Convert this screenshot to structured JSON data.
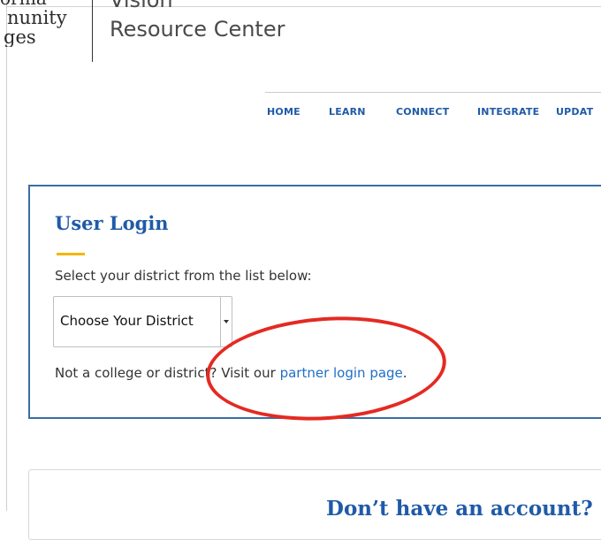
{
  "header": {
    "logo_lines": [
      "ornia",
      "nunity",
      "ges"
    ],
    "site_title_line1": "Vision",
    "site_title_line2": "Resource Center"
  },
  "nav": {
    "items": [
      {
        "label": "HOME"
      },
      {
        "label": "LEARN"
      },
      {
        "label": "CONNECT"
      },
      {
        "label": "INTEGRATE"
      },
      {
        "label": "UPDAT"
      }
    ]
  },
  "login": {
    "title": "User Login",
    "select_label": "Select your district from the list below:",
    "district_select_value": "Choose Your District",
    "partner_prefix": "Not a college or district? Visit our",
    "partner_link": "partner login page",
    "partner_suffix": "."
  },
  "signup": {
    "title": "Don’t have an account?"
  },
  "colors": {
    "accent_blue": "#1f5aa8",
    "card_border": "#3a6ea5",
    "accent_gold": "#f2b705",
    "annotation_red": "#e42a22",
    "link_blue": "#1f6fc7"
  }
}
